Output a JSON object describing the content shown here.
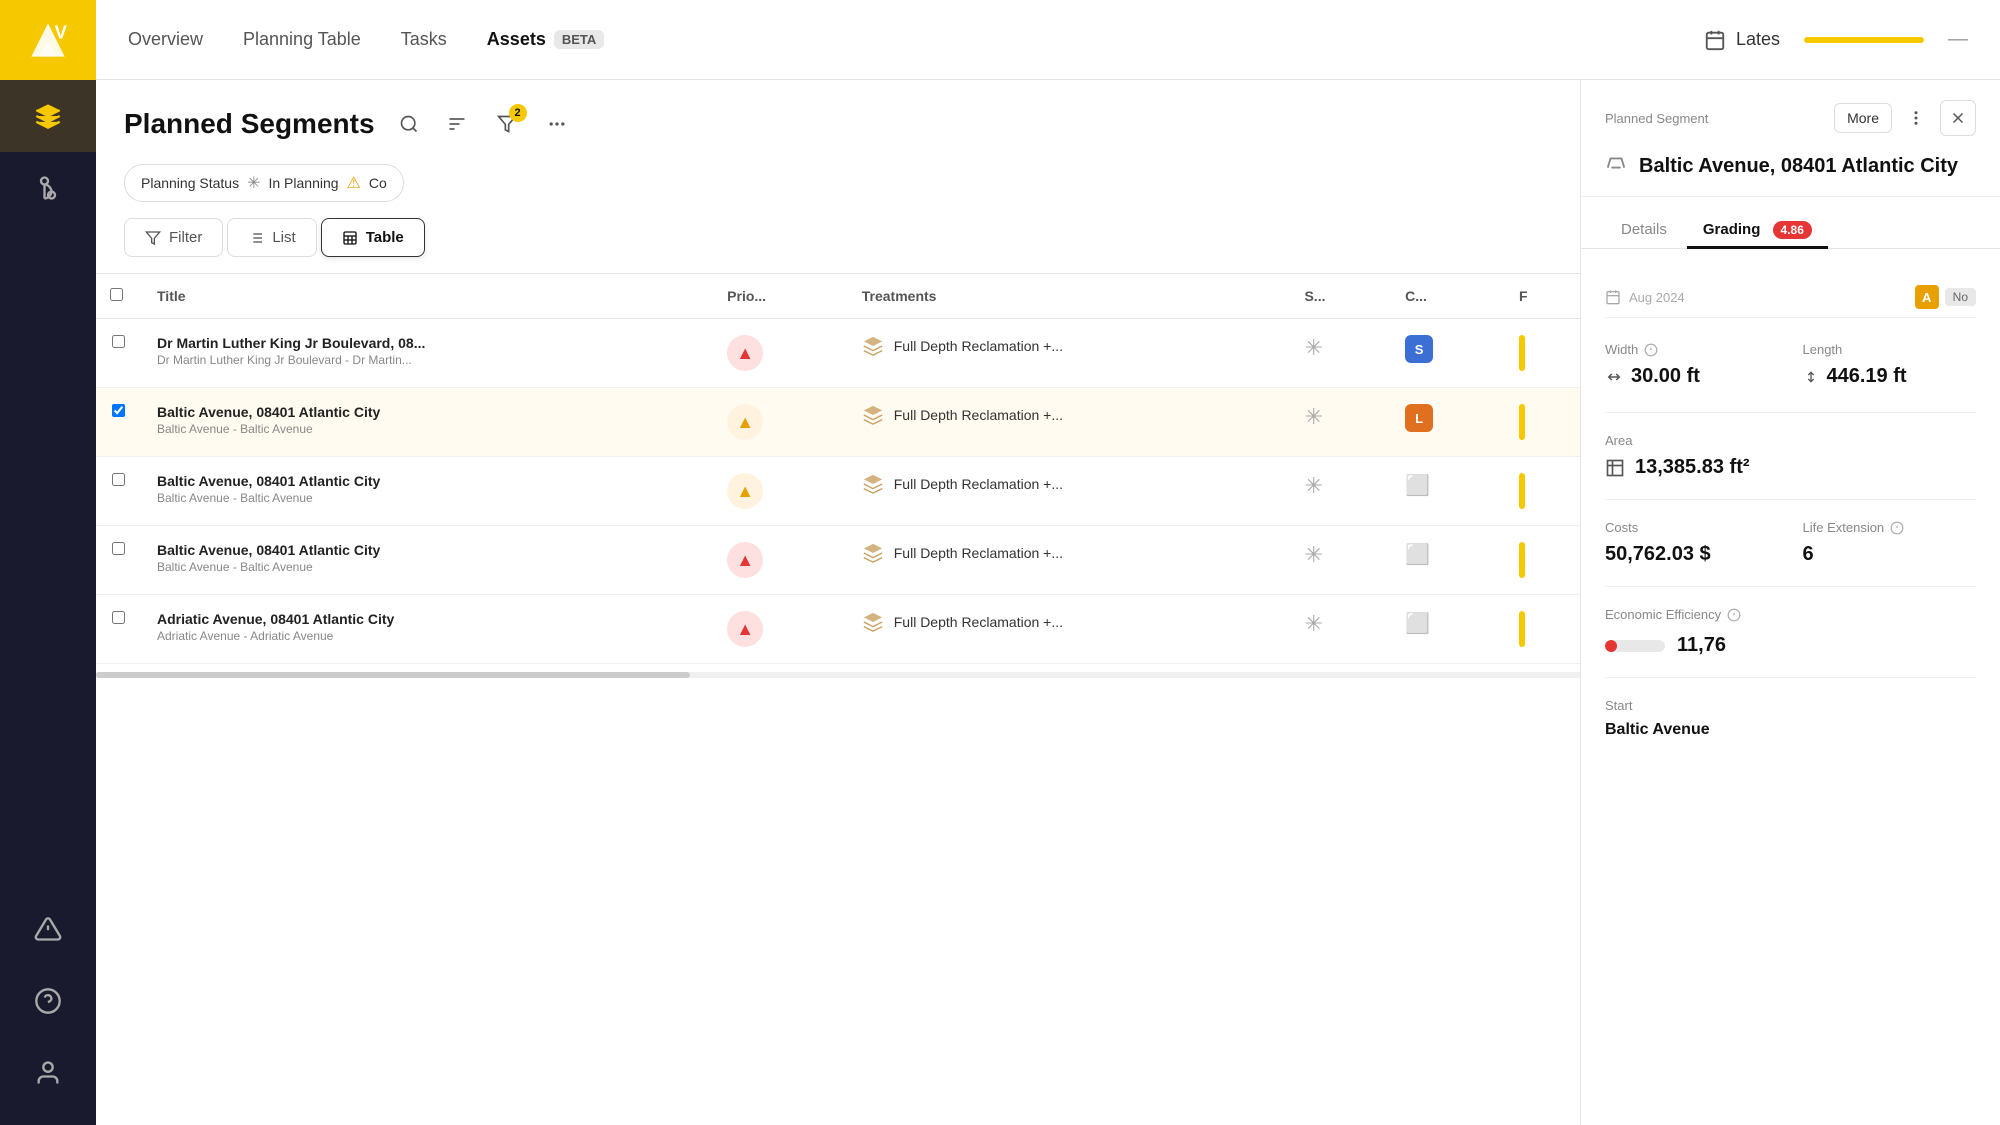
{
  "sidebar": {
    "logo_alt": "logo",
    "items": [
      {
        "id": "layers",
        "label": "Layers",
        "icon": "layers-icon",
        "active": true
      },
      {
        "id": "route",
        "label": "Route",
        "icon": "route-icon",
        "active": false
      },
      {
        "id": "warning",
        "label": "Warning",
        "icon": "warning-icon",
        "active": false
      },
      {
        "id": "help",
        "label": "Help",
        "icon": "help-icon",
        "active": false
      },
      {
        "id": "user",
        "label": "User",
        "icon": "user-icon",
        "active": false
      }
    ]
  },
  "topnav": {
    "items": [
      {
        "id": "overview",
        "label": "Overview",
        "active": false
      },
      {
        "id": "planning-table",
        "label": "Planning Table",
        "active": false
      },
      {
        "id": "tasks",
        "label": "Tasks",
        "active": false
      },
      {
        "id": "assets",
        "label": "Assets",
        "beta": true,
        "active": true
      }
    ],
    "lates_label": "Lates"
  },
  "panel": {
    "title": "Planned Segments",
    "filter_label": "Planning Status",
    "chip_in_planning": "In Planning",
    "chip_co": "Co",
    "filter_count": "2",
    "view_filter": "Filter",
    "view_list": "List",
    "view_table": "Table"
  },
  "table": {
    "columns": [
      "Title",
      "Prio...",
      "Treatments",
      "S...",
      "C...",
      "F"
    ],
    "rows": [
      {
        "id": 1,
        "title": "Dr Martin Luther King Jr Boulevard, 08...",
        "subtitle": "Dr Martin Luther King Jr Boulevard - Dr Martin...",
        "priority": "high",
        "priority_icon": "↑",
        "treatment": "Full Depth Reclamation +...",
        "status": "asterisk",
        "col_c": "S",
        "col_c_color": "#3b6fd4",
        "selected": false
      },
      {
        "id": 2,
        "title": "Baltic Avenue, 08401 Atlantic City",
        "subtitle": "Baltic Avenue - Baltic Avenue",
        "priority": "medium",
        "priority_icon": "↑",
        "treatment": "Full Depth Reclamation +...",
        "status": "asterisk",
        "col_c": "L",
        "col_c_color": "#e07020",
        "selected": true
      },
      {
        "id": 3,
        "title": "Baltic Avenue, 08401 Atlantic City",
        "subtitle": "Baltic Avenue - Baltic Avenue",
        "priority": "medium",
        "priority_icon": "↑",
        "treatment": "Full Depth Reclamation +...",
        "status": "asterisk",
        "col_c": "",
        "col_c_color": "",
        "selected": false
      },
      {
        "id": 4,
        "title": "Baltic Avenue, 08401 Atlantic City",
        "subtitle": "Baltic Avenue - Baltic Avenue",
        "priority": "high",
        "priority_icon": "↑",
        "treatment": "Full Depth Reclamation +...",
        "status": "asterisk",
        "col_c": "",
        "col_c_color": "",
        "selected": false
      },
      {
        "id": 5,
        "title": "Adriatic Avenue, 08401 Atlantic City",
        "subtitle": "Adriatic Avenue - Adriatic Avenue",
        "priority": "high",
        "priority_icon": "↑",
        "treatment": "Full Depth Reclamation +...",
        "status": "asterisk",
        "col_c": "",
        "col_c_color": "",
        "selected": false
      }
    ]
  },
  "right_panel": {
    "label": "Planned Segment",
    "more_btn": "More",
    "title": "Baltic Avenue, 08401 Atlantic City",
    "tab_details": "Details",
    "tab_grading": "Grading",
    "grading_score": "4.86",
    "width_label": "Width",
    "width_value": "30.00 ft",
    "length_label": "Length",
    "length_value": "446.19 ft",
    "area_label": "Area",
    "area_value": "13,385.83 ft²",
    "costs_label": "Costs",
    "costs_value": "50,762.03 $",
    "life_ext_label": "Life Extension",
    "life_ext_value": "6",
    "efficiency_label": "Economic Efficiency",
    "efficiency_value": "11,76",
    "efficiency_pct": 20,
    "start_label": "Start",
    "start_value": "Baltic Avenue"
  }
}
